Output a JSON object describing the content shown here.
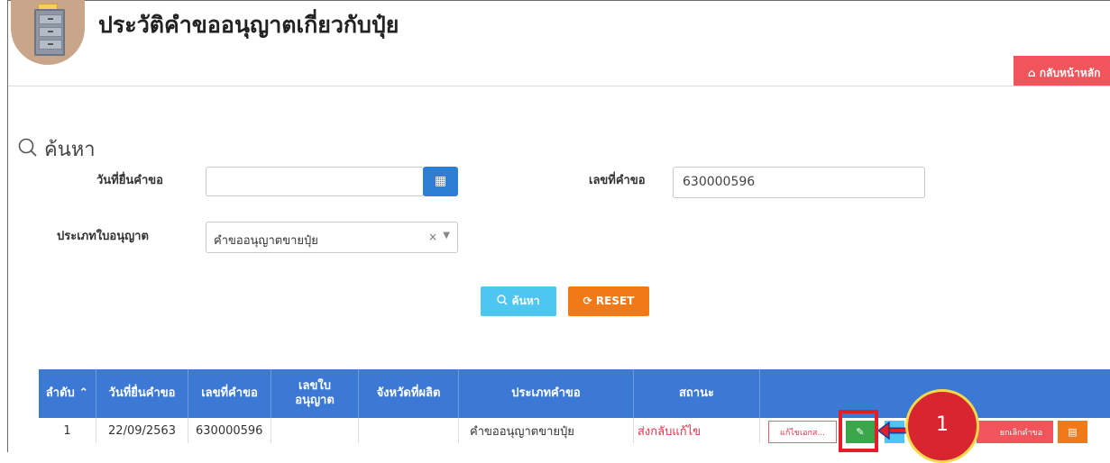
{
  "header": {
    "title": "ประวัติคำขออนุญาตเกี่ยวกับปุ๋ย",
    "home_button": "กลับหน้าหลัก"
  },
  "search": {
    "heading": "ค้นหา",
    "date_label": "วันที่ยื่นคำขอ",
    "date_value": "",
    "request_no_label": "เลขที่คำขอ",
    "request_no_value": "630000596",
    "license_type_label": "ประเภทใบอนุญาต",
    "license_type_value": "คำขออนุญาตขายปุ๋ย",
    "clear_symbol": "×",
    "search_button": "ค้นหา",
    "reset_button": "RESET"
  },
  "table": {
    "headers": [
      "ลำดับ",
      "วันที่ยื่นคำขอ",
      "เลขที่คำขอ",
      "เลขใบ อนุญาต",
      "จังหวัดที่ผลิต",
      "ประเภทคำขอ",
      "สถานะ",
      ""
    ],
    "sort_indicator": "⌃",
    "rows": [
      {
        "index": "1",
        "date": "22/09/2563",
        "request_no": "630000596",
        "license_no": "",
        "province": "",
        "type": "คำขออนุญาตขายปุ๋ย",
        "status": "ส่งกลับแก้ไข",
        "actions": {
          "edit_docs": "แก้ไขเอกส...",
          "cancel": "ยกเลิกคำขอ"
        }
      }
    ]
  },
  "annotation": {
    "step_number": "1"
  },
  "colors": {
    "header_blue": "#3c79d4",
    "home_red": "#f2545b",
    "search_cyan": "#4dc6f2",
    "reset_orange": "#f07a17",
    "status_red": "#d9364a",
    "edit_green": "#3aa64a",
    "highlight_red": "#e41e26"
  }
}
